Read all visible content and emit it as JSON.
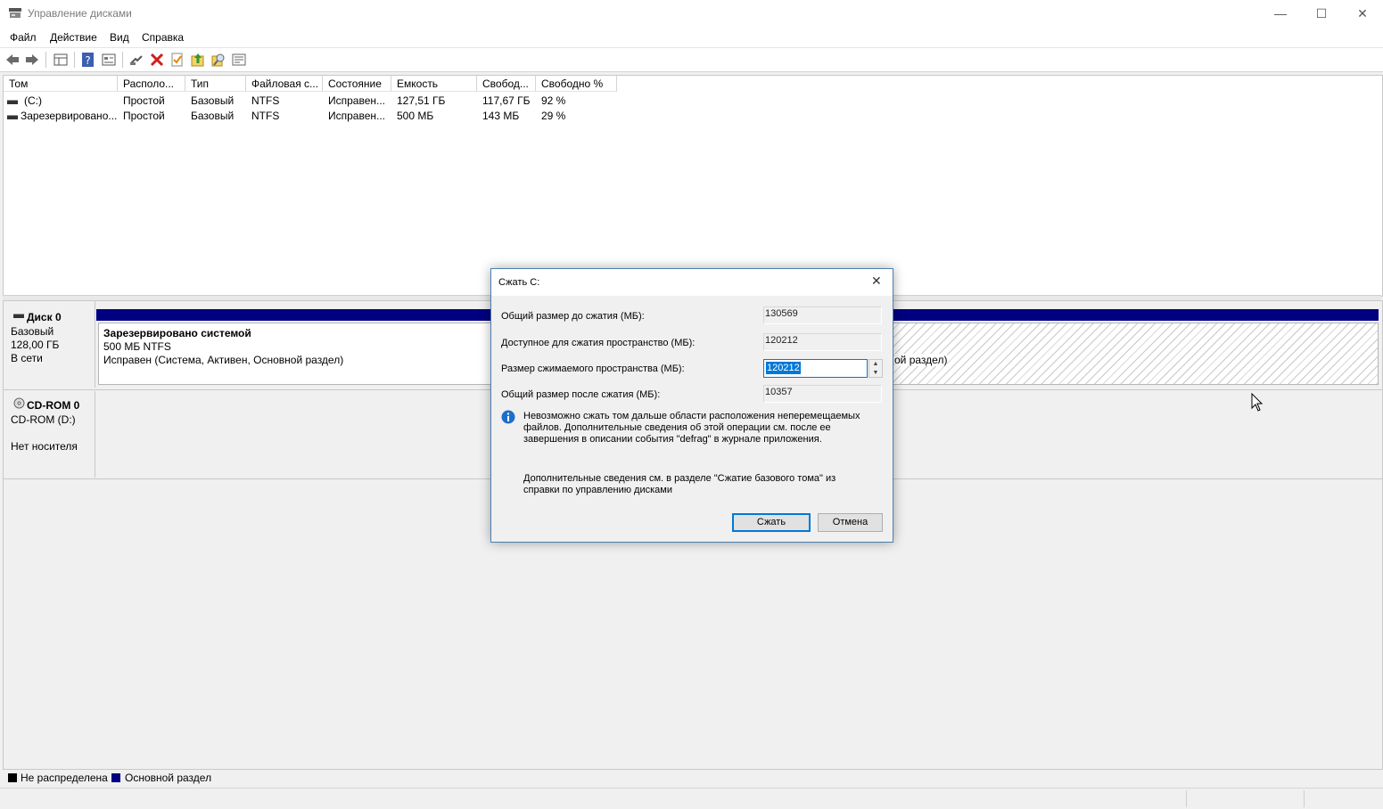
{
  "window": {
    "title": "Управление дисками",
    "minimize": "—",
    "maximize": "☐",
    "close": "✕"
  },
  "menu": [
    "Файл",
    "Действие",
    "Вид",
    "Справка"
  ],
  "toolbar_icons": [
    "back-icon",
    "forward-icon",
    "properties-grid-icon",
    "help-icon",
    "view-icon",
    "connect-icon",
    "delete-icon",
    "check-icon",
    "import-icon",
    "search-icon",
    "list-icon"
  ],
  "volumes": {
    "columns": [
      "Том",
      "Располо...",
      "Тип",
      "Файловая с...",
      "Состояние",
      "Емкость",
      "Свобод...",
      "Свободно %"
    ],
    "rows": [
      [
        "(C:)",
        "Простой",
        "Базовый",
        "NTFS",
        "Исправен...",
        "127,51 ГБ",
        "117,67 ГБ",
        "92 %"
      ],
      [
        "Зарезервировано...",
        "Простой",
        "Базовый",
        "NTFS",
        "Исправен...",
        "500 МБ",
        "143 МБ",
        "29 %"
      ]
    ]
  },
  "disks": {
    "disk0": {
      "name": "Диск 0",
      "type": "Базовый",
      "size": "128,00 ГБ",
      "status": "В сети",
      "part1": {
        "name": "Зарезервировано системой",
        "size": "500 МБ NTFS",
        "status": "Исправен (Система, Активен, Основной раздел)"
      },
      "part2_fragment": "ой раздел)"
    },
    "cdrom0": {
      "name": "CD-ROM 0",
      "drive": "CD-ROM (D:)",
      "status": "Нет носителя"
    }
  },
  "legend": [
    {
      "label": "Не распределена",
      "color": "#000000"
    },
    {
      "label": "Основной раздел",
      "color": "#000080"
    }
  ],
  "colors": {
    "partition_bar": "#000080",
    "dialog_border": "#4c7fb1",
    "focus": "#0078d7"
  },
  "dialog": {
    "title": "Сжать C:",
    "total_before_label": "Общий размер до сжатия (МБ):",
    "total_before": "130569",
    "available_label": "Доступное для сжатия пространство (МБ):",
    "available": "120212",
    "shrink_label": "Размер сжимаемого пространства (МБ):",
    "shrink_value": "120212",
    "total_after_label": "Общий размер после сжатия (МБ):",
    "total_after": "10357",
    "info_line1": "Невозможно сжать том дальше области расположения неперемещаемых",
    "info_line2": "файлов. Дополнительные сведения об этой операции см. после ее",
    "info_line3": "завершения в описании события \"defrag\" в журнале приложения.",
    "more_line1": "Дополнительные сведения см. в разделе \"Сжатие базового тома\" из",
    "more_line2": "справки по управлению дисками",
    "ok_label": "Сжать",
    "cancel_label": "Отмена"
  }
}
